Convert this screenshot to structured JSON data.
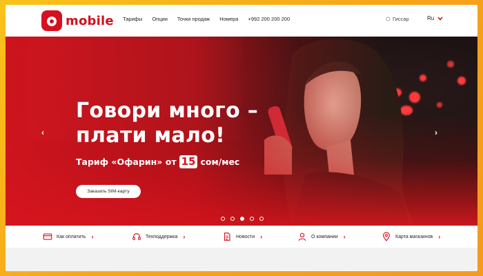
{
  "header": {
    "logo_text": "mobile",
    "nav": [
      "Тарифы",
      "Опции",
      "Точки продаж",
      "Номера",
      "+992 200 200 200"
    ],
    "location": "Гиссар",
    "language": "Ru"
  },
  "hero": {
    "title_line1": "Говори много –",
    "title_line2": "плати мало!",
    "subtitle_prefix": "Тариф «Офарин» от",
    "price": "15",
    "subtitle_suffix": "сом/мес",
    "cta_label": "Заказать SIM-карту",
    "slides_total": 5,
    "active_slide": 3
  },
  "quick_links": [
    {
      "label": "Как оплатить",
      "icon": "card-icon"
    },
    {
      "label": "Техподдержка",
      "icon": "headset-icon"
    },
    {
      "label": "Новости",
      "icon": "document-icon"
    },
    {
      "label": "О компании",
      "icon": "user-icon"
    },
    {
      "label": "Карта магазинов",
      "icon": "map-pin-icon"
    }
  ],
  "colors": {
    "brand_red": "#d6101e",
    "frame_background": "#f7a319"
  }
}
